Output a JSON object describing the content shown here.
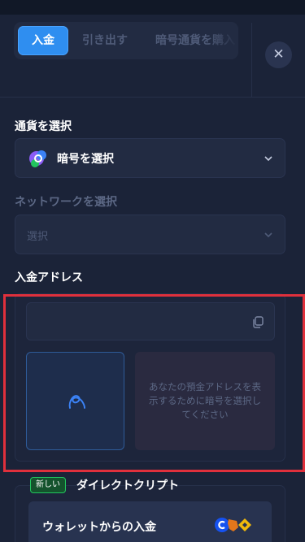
{
  "tabs": [
    {
      "label": "入金",
      "active": true
    },
    {
      "label": "引き出す",
      "active": false
    },
    {
      "label": "暗号通貨を購入",
      "active": false
    }
  ],
  "close_icon": "close-icon",
  "currency": {
    "label": "通貨を選択",
    "value": "暗号を選択",
    "icon": "crypto-coin-icon"
  },
  "network": {
    "label": "ネットワークを選択",
    "placeholder": "選択"
  },
  "deposit_address": {
    "label": "入金アドレス",
    "copy_icon": "copy-icon",
    "qr_icon": "loading-spinner-icon",
    "info_text": "あなたの預金アドレスを表示するために暗号を選択してください"
  },
  "direct_crypto": {
    "badge": "新しい",
    "title": "ダイレクトクリプト",
    "wallet_button": "ウォレットからの入金",
    "wallet_icons": [
      "coinbase-icon",
      "metamask-icon",
      "binance-icon"
    ]
  },
  "colors": {
    "accent": "#2f8ef0",
    "background": "#1b2338",
    "highlight": "#e0303c",
    "badge": "#22c55e"
  }
}
